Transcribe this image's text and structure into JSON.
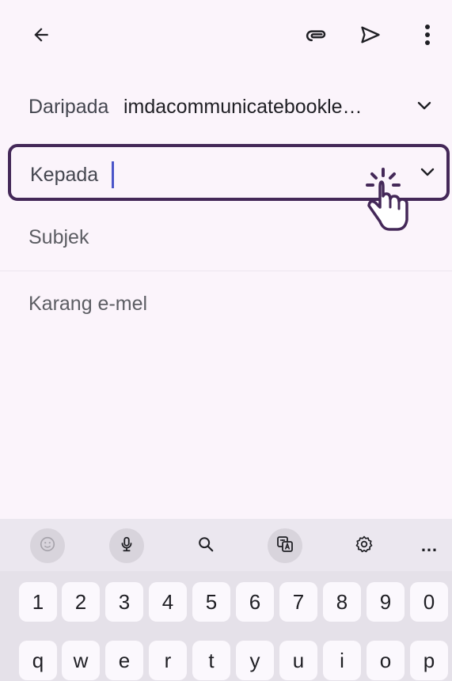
{
  "toolbar": {
    "back_icon": "arrow-left-icon",
    "attach_icon": "paperclip-icon",
    "send_icon": "send-icon",
    "more_icon": "more-vertical-icon"
  },
  "compose": {
    "from_label": "Daripada",
    "from_value": "imdacommunicatebookle…",
    "to_label": "Kepada",
    "subject_label": "Subjek",
    "body_placeholder": "Karang e-mel"
  },
  "keyboard": {
    "toolbar_icons": [
      "emoji-icon",
      "microphone-icon",
      "search-icon",
      "translate-icon",
      "settings-icon",
      "more-horizontal-icon"
    ],
    "more_label": "…",
    "number_row": [
      "1",
      "2",
      "3",
      "4",
      "5",
      "6",
      "7",
      "8",
      "9",
      "0"
    ],
    "letter_row": [
      "q",
      "w",
      "e",
      "r",
      "t",
      "y",
      "u",
      "i",
      "o",
      "p"
    ]
  },
  "colors": {
    "background": "#fbf4fb",
    "focus_border": "#442858",
    "caret": "#4b55c9"
  }
}
